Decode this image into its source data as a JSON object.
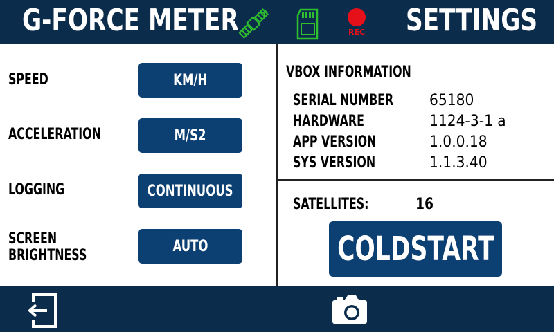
{
  "header": {
    "title": "G-FORCE METER",
    "screen_title": "SETTINGS",
    "status_icons": {
      "gps": "satellite-icon",
      "storage": "sd-card-icon",
      "recording": "record-icon"
    },
    "rec_label": "REC",
    "colors": {
      "bar": "#0c2c4c",
      "gps": "#2fbf2f",
      "sd": "#2fbf2f",
      "rec": "#e5101a"
    }
  },
  "settings": [
    {
      "label": "SPEED",
      "value": "KM/H"
    },
    {
      "label": "ACCELERATION",
      "value": "M/S2"
    },
    {
      "label": "LOGGING",
      "value": "CONTINUOUS"
    },
    {
      "label": "SCREEN BRIGHTNESS",
      "label_lines": [
        "SCREEN",
        "BRIGHTNESS"
      ],
      "value": "AUTO"
    }
  ],
  "vbox_info": {
    "heading": "VBOX INFORMATION",
    "rows": [
      {
        "key": "SERIAL NUMBER",
        "value": "65180"
      },
      {
        "key": "HARDWARE",
        "value": "1124-3-1 a"
      },
      {
        "key": "APP VERSION",
        "value": "1.0.0.18"
      },
      {
        "key": "SYS VERSION",
        "value": "1.1.3.40"
      }
    ]
  },
  "satellites": {
    "label": "SATELLITES:",
    "value": "16"
  },
  "coldstart_label": "COLDSTART",
  "footer": {
    "exit_icon": "exit-icon",
    "camera_icon": "camera-icon"
  },
  "accent_button_color": "#0c3f72"
}
